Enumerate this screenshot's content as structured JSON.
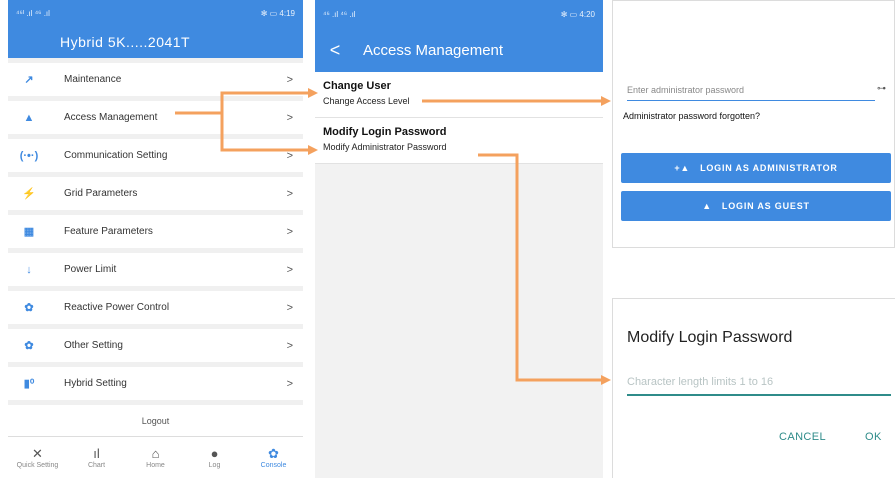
{
  "colors": {
    "primary": "#3f8ae0",
    "arrow": "#f4a15e",
    "teal": "#2f8c8a"
  },
  "panel1": {
    "status_left": "⁴⁶ᴵ .ıl ⁴⁶ .ıl",
    "status_right": "✻ ▭ 4:19",
    "app_title": "Hybrid 5K.....2041T",
    "menu": [
      {
        "label": "Maintenance",
        "icon": "wrench-icon",
        "glyph": "↗"
      },
      {
        "label": "Access Management",
        "icon": "user-icon",
        "glyph": "▲"
      },
      {
        "label": "Communication Setting",
        "icon": "signal-icon",
        "glyph": "(·•·)"
      },
      {
        "label": "Grid Parameters",
        "icon": "bolt-icon",
        "glyph": "⚡"
      },
      {
        "label": "Feature Parameters",
        "icon": "grid-icon",
        "glyph": "▦"
      },
      {
        "label": "Power Limit",
        "icon": "arrow-down-icon",
        "glyph": "↓"
      },
      {
        "label": "Reactive Power Control",
        "icon": "gear-icon",
        "glyph": "✿"
      },
      {
        "label": "Other Setting",
        "icon": "gear-icon",
        "glyph": "✿"
      },
      {
        "label": "Hybrid Setting",
        "icon": "battery-icon",
        "glyph": "▮⁰"
      }
    ],
    "chevron": ">",
    "logout_label": "Logout",
    "tabs": [
      {
        "label": "Quick Setting",
        "icon": "tools-icon",
        "glyph": "✕"
      },
      {
        "label": "Chart",
        "icon": "chart-icon",
        "glyph": "ıl"
      },
      {
        "label": "Home",
        "icon": "home-icon",
        "glyph": "⌂"
      },
      {
        "label": "Log",
        "icon": "info-icon",
        "glyph": "●"
      },
      {
        "label": "Console",
        "icon": "gear-icon",
        "glyph": "✿"
      }
    ]
  },
  "panel2": {
    "status_left": "⁴⁶ .ıl ⁴⁶ .ıl",
    "status_right": "✻ ▭ 4:20",
    "back_glyph": "<",
    "title": "Access Management",
    "items": [
      {
        "title": "Change User",
        "subtitle": "Change Access Level"
      },
      {
        "title": "Modify Login Password",
        "subtitle": "Modify Administrator Password"
      }
    ]
  },
  "panel3": {
    "password_placeholder": "Enter administrator password",
    "eye_glyph": "⊶",
    "forgot_text": "Administrator password forgotten?",
    "login_admin_label": "LOGIN AS ADMINISTRATOR",
    "login_admin_glyph": "+▲",
    "login_guest_label": "LOGIN AS GUEST",
    "login_guest_glyph": "▲"
  },
  "panel4": {
    "title": "Modify Login Password",
    "input_placeholder": "Character length limits 1 to 16",
    "cancel_label": "CANCEL",
    "ok_label": "OK"
  }
}
